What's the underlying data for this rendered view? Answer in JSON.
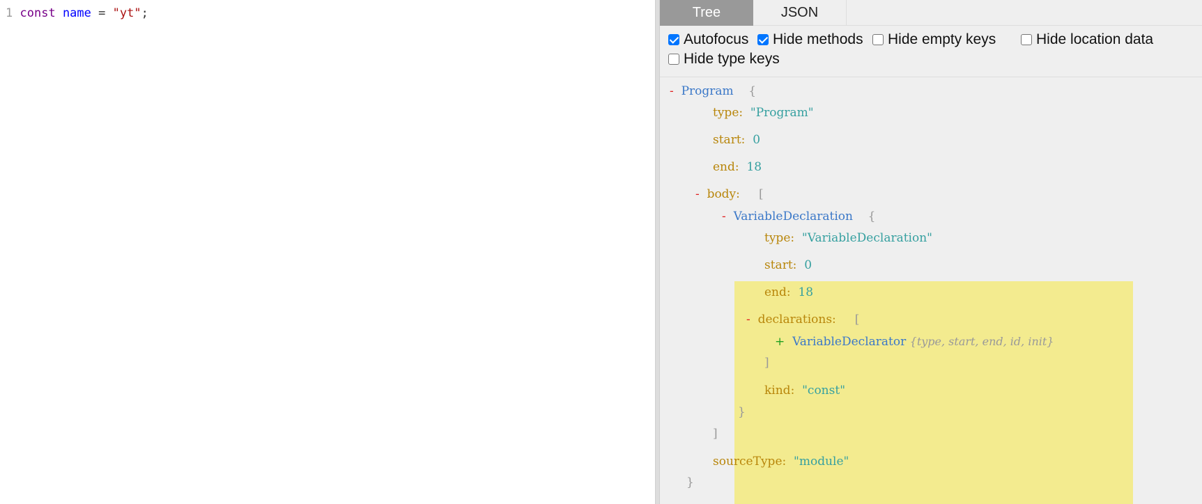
{
  "editor": {
    "line_number": "1",
    "code": {
      "keyword": "const",
      "identifier": "name",
      "operator": "=",
      "string": "\"yt\"",
      "terminator": ";"
    }
  },
  "tabs": [
    {
      "label": "Tree",
      "active": true
    },
    {
      "label": "JSON",
      "active": false
    }
  ],
  "options": [
    {
      "label": "Autofocus",
      "checked": true
    },
    {
      "label": "Hide methods",
      "checked": true
    },
    {
      "label": "Hide empty keys",
      "checked": false
    },
    {
      "label": "Hide location data",
      "checked": false
    },
    {
      "label": "Hide type keys",
      "checked": false
    }
  ],
  "tree": {
    "toggle_minus": "-",
    "toggle_plus": "+",
    "open_brace": "{",
    "close_brace": "}",
    "open_bracket": "[",
    "close_bracket": "]",
    "program": {
      "node": "Program",
      "type_key": "type:",
      "type_value": "\"Program\"",
      "start_key": "start:",
      "start_value": "0",
      "end_key": "end:",
      "end_value": "18",
      "body_key": "body:",
      "source_type_key": "sourceType:",
      "source_type_value": "\"module\""
    },
    "declaration": {
      "node": "VariableDeclaration",
      "type_key": "type:",
      "type_value": "\"VariableDeclaration\"",
      "start_key": "start:",
      "start_value": "0",
      "end_key": "end:",
      "end_value": "18",
      "declarations_key": "declarations:",
      "kind_key": "kind:",
      "kind_value": "\"const\""
    },
    "declarator": {
      "node": "VariableDeclarator",
      "summary": "{type, start, end, id, init}"
    }
  },
  "colors": {
    "highlight": "#f3eb8f",
    "active_tab": "#999999",
    "node": "#3b78c8",
    "key": "#b8860b",
    "value": "#36a0a0",
    "collapse_toggle": "#e02020",
    "expand_toggle": "#20a020"
  }
}
